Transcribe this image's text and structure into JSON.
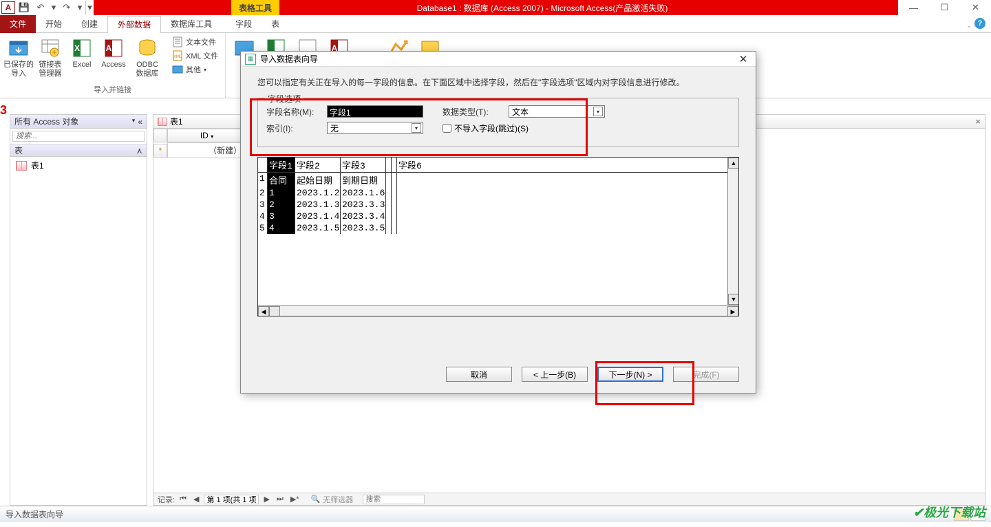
{
  "titlebar": {
    "app_title": "Database1 : 数据库 (Access 2007)  -  Microsoft Access(产品激活失败)",
    "contextual_title": "表格工具"
  },
  "ribbon": {
    "tabs": {
      "file": "文件",
      "home": "开始",
      "create": "创建",
      "external": "外部数据",
      "dbtools": "数据库工具",
      "fields": "字段",
      "table": "表"
    },
    "external": {
      "saved_imports": "已保存的\n导入",
      "linked_table_mgr": "链接表\n管理器",
      "excel": "Excel",
      "access": "Access",
      "odbc": "ODBC\n数据库",
      "text_file": "文本文件",
      "xml_file": "XML 文件",
      "other": "其他",
      "group_label": "导入并链接",
      "right_access": "Access"
    }
  },
  "nav_pane": {
    "header": "所有 Access 对象",
    "search_placeholder": "搜索...",
    "section": "表",
    "item": "表1"
  },
  "datasheet": {
    "tab_name": "表1",
    "col_id": "ID",
    "new_row": "（新建）",
    "record_label": "记录:",
    "record_pos": "第 1 项(共 1 项)",
    "no_filter": "无筛选器",
    "search": "搜索"
  },
  "dialog": {
    "title": "导入数据表向导",
    "description": "您可以指定有关正在导入的每一字段的信息。在下面区域中选择字段，然后在\"字段选项\"区域内对字段信息进行修改。",
    "fieldset_legend": "字段选项",
    "field_name_label": "字段名称(M):",
    "field_name_value": "字段1",
    "data_type_label": "数据类型(T):",
    "data_type_value": "文本",
    "index_label": "索引(I):",
    "index_value": "无",
    "skip_label": "不导入字段(跳过)(S)",
    "skip_checked": false,
    "preview": {
      "headers": [
        "",
        "字段1",
        "字段2",
        "字段3",
        "",
        "",
        "字段6"
      ],
      "rows": [
        {
          "n": "1",
          "c1": "合同",
          "c2": "起始日期",
          "c3": "到期日期"
        },
        {
          "n": "2",
          "c1": "1",
          "c2": "2023.1.2",
          "c3": "2023.1.6"
        },
        {
          "n": "3",
          "c1": "2",
          "c2": "2023.1.3",
          "c3": "2023.3.3"
        },
        {
          "n": "4",
          "c1": "3",
          "c2": "2023.1.4",
          "c3": "2023.3.4"
        },
        {
          "n": "5",
          "c1": "4",
          "c2": "2023.1.5",
          "c3": "2023.3.5"
        }
      ]
    },
    "buttons": {
      "cancel": "取消",
      "back": "< 上一步(B)",
      "next": "下一步(N) >",
      "finish": "完成(F)"
    }
  },
  "status_bar": {
    "text": "导入数据表向导"
  },
  "watermark": "极光下载站"
}
